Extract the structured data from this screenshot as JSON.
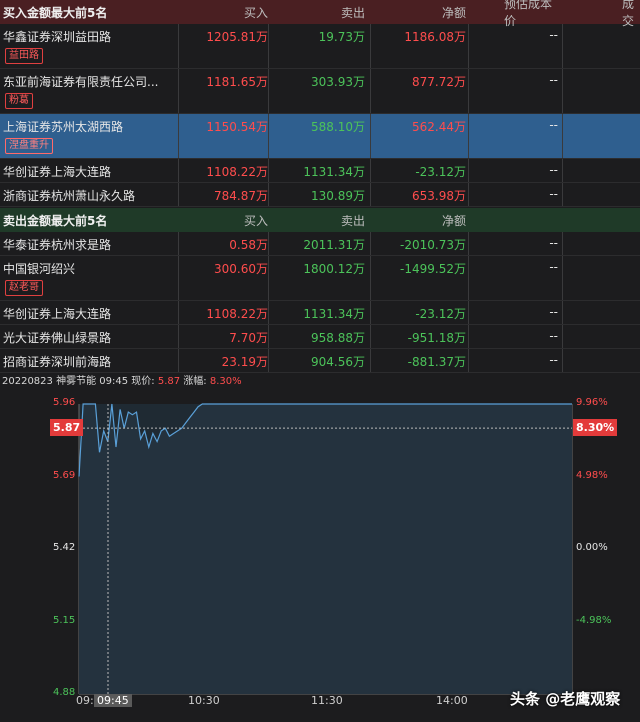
{
  "buy_section": {
    "title": "买入金额最大前5名",
    "cols": [
      "买入",
      "卖出",
      "净额",
      "预估成本价",
      "成交"
    ],
    "rows": [
      {
        "name": "华鑫证券深圳益田路",
        "buy": "1205.81万",
        "sell": "19.73万",
        "net": "1186.08万",
        "cost": "--",
        "tag": "益田路",
        "net_color": "red"
      },
      {
        "name": "东亚前海证券有限责任公司...",
        "buy": "1181.65万",
        "sell": "303.93万",
        "net": "877.72万",
        "cost": "--",
        "tag": "粉葛",
        "net_color": "red"
      },
      {
        "name": "上海证券苏州太湖西路",
        "buy": "1150.54万",
        "sell": "588.10万",
        "net": "562.44万",
        "cost": "--",
        "tag": "涅盘重升",
        "net_color": "red",
        "selected": true
      },
      {
        "name": "华创证券上海大连路",
        "buy": "1108.22万",
        "sell": "1131.34万",
        "net": "-23.12万",
        "cost": "--",
        "tag": "",
        "net_color": "green"
      },
      {
        "name": "浙商证券杭州萧山永久路",
        "buy": "784.87万",
        "sell": "130.89万",
        "net": "653.98万",
        "cost": "--",
        "tag": "",
        "net_color": "red"
      }
    ]
  },
  "sell_section": {
    "title": "卖出金额最大前5名",
    "cols": [
      "买入",
      "卖出",
      "净额"
    ],
    "rows": [
      {
        "name": "华泰证券杭州求是路",
        "buy": "0.58万",
        "sell": "2011.31万",
        "net": "-2010.73万",
        "cost": "--",
        "tag": ""
      },
      {
        "name": "中国银河绍兴",
        "buy": "300.60万",
        "sell": "1800.12万",
        "net": "-1499.52万",
        "cost": "--",
        "tag": "赵老哥"
      },
      {
        "name": "华创证券上海大连路",
        "buy": "1108.22万",
        "sell": "1131.34万",
        "net": "-23.12万",
        "cost": "--",
        "tag": ""
      },
      {
        "name": "光大证券佛山绿景路",
        "buy": "7.70万",
        "sell": "958.88万",
        "net": "-951.18万",
        "cost": "--",
        "tag": ""
      },
      {
        "name": "招商证券深圳前海路",
        "buy": "23.19万",
        "sell": "904.56万",
        "net": "-881.37万",
        "cost": "--",
        "tag": ""
      }
    ]
  },
  "chart_info": {
    "date": "20220823",
    "stock": "神雾节能",
    "time": "09:45",
    "price_label": "现价:",
    "price": "5.87",
    "change_label": "涨幅:",
    "change": "8.30%"
  },
  "chart_data": {
    "type": "line",
    "title": "",
    "y_left_ticks": [
      "5.96",
      "5.69",
      "5.42",
      "5.15",
      "4.88"
    ],
    "y_right_ticks": [
      "9.96%",
      "4.98%",
      "0.00%",
      "-4.98%"
    ],
    "y_left_colors": [
      "#ff4d4d",
      "#ff4d4d",
      "#e6e6e6",
      "#4cc35a",
      "#4cc35a"
    ],
    "x_ticks": [
      "09:",
      "09:45",
      "10:30",
      "11:30",
      "14:00"
    ],
    "ylim": [
      4.88,
      5.96
    ],
    "prev_close": 5.42,
    "crosshair_price": "5.87",
    "crosshair_pct": "8.30%",
    "x": [
      0,
      2,
      4,
      6,
      8,
      10,
      12,
      14,
      16,
      18,
      20,
      22,
      24,
      26,
      28,
      30,
      32,
      34,
      36,
      38,
      40,
      42,
      44,
      46,
      48,
      50,
      52,
      54,
      56,
      58,
      60,
      62,
      64,
      66,
      68,
      70,
      75,
      80,
      90,
      100,
      120,
      150,
      180,
      210,
      240
    ],
    "values": [
      5.69,
      5.96,
      5.96,
      5.96,
      5.96,
      5.78,
      5.86,
      5.82,
      5.96,
      5.8,
      5.94,
      5.87,
      5.93,
      5.92,
      5.93,
      5.83,
      5.86,
      5.8,
      5.85,
      5.82,
      5.86,
      5.87,
      5.84,
      5.85,
      5.86,
      5.87,
      5.89,
      5.91,
      5.93,
      5.95,
      5.96,
      5.96,
      5.96,
      5.96,
      5.96,
      5.96,
      5.96,
      5.96,
      5.96,
      5.96,
      5.96,
      5.96,
      5.96,
      5.96,
      5.96
    ],
    "line_color": "#5aa0d8"
  },
  "watermark": "头条 @老鹰观察"
}
